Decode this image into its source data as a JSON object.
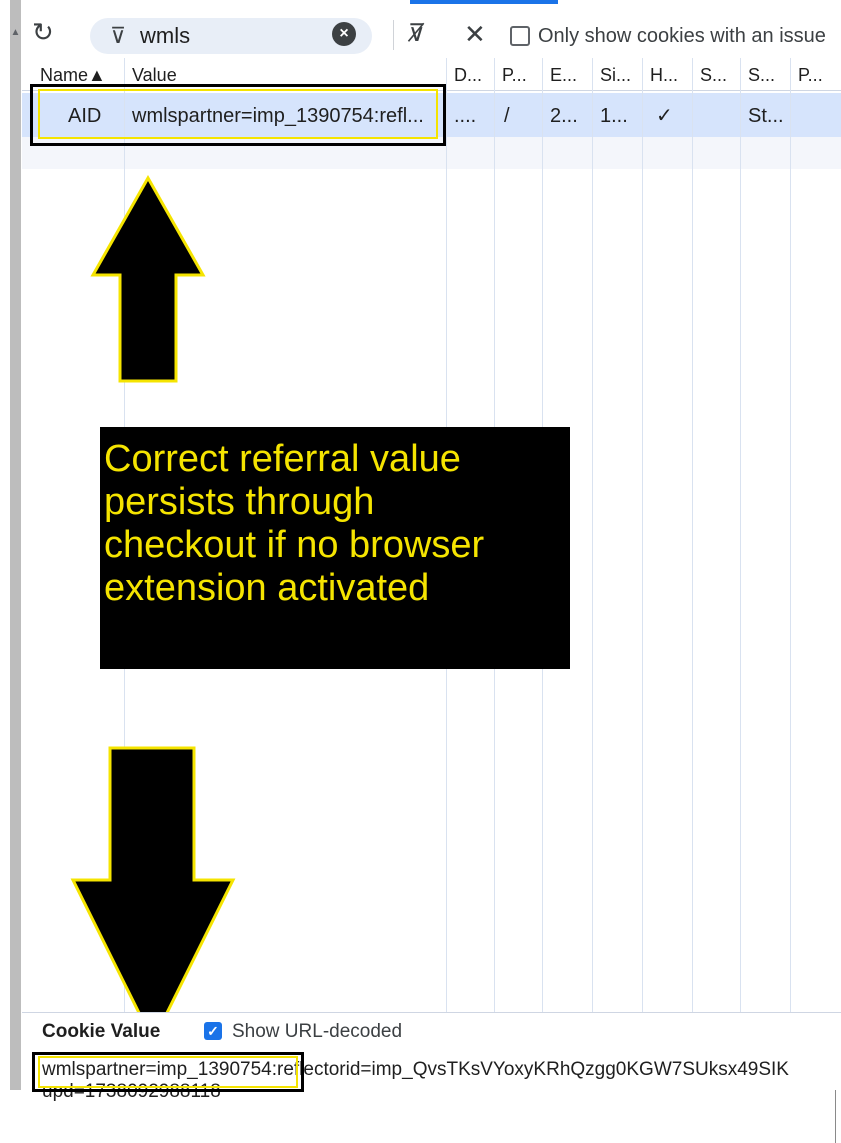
{
  "toolbar": {
    "filter_value": "wmls",
    "only_issues_label": "Only show cookies with an issue"
  },
  "table": {
    "headers": [
      "Name▲",
      "Value",
      "D...",
      "P...",
      "E...",
      "Si...",
      "H...",
      "S...",
      "S...",
      "P..."
    ],
    "row": {
      "name": "AID",
      "value": "wmlspartner=imp_1390754:refl...",
      "domain": "....",
      "path": "/",
      "expires": "2...",
      "size": "1...",
      "httponly": "✓",
      "secure": "",
      "samesite": "St...",
      "priority": ""
    }
  },
  "callout": {
    "lines": [
      "Correct referral value",
      "persists through",
      "checkout if no browser",
      "extension activated"
    ],
    "text_color": "#f5e400",
    "background": "#000000"
  },
  "cookie_value_pane": {
    "label": "Cookie Value",
    "show_url_decoded_label": "Show URL-decoded",
    "show_url_decoded_checked": true,
    "value_line1": "wmlspartner=imp_1390754:reflectorid=imp_QvsTKsVYoxyKRhQzgg0KGW7SUksx49SIK",
    "value_line2": "upd=1738092988118"
  },
  "icons": [
    "refresh-icon",
    "filter-icon",
    "clear-icon",
    "clear-filters-icon",
    "close-icon",
    "checkbox-icon",
    "check-icon",
    "up-arrow-annotation",
    "down-arrow-annotation"
  ]
}
